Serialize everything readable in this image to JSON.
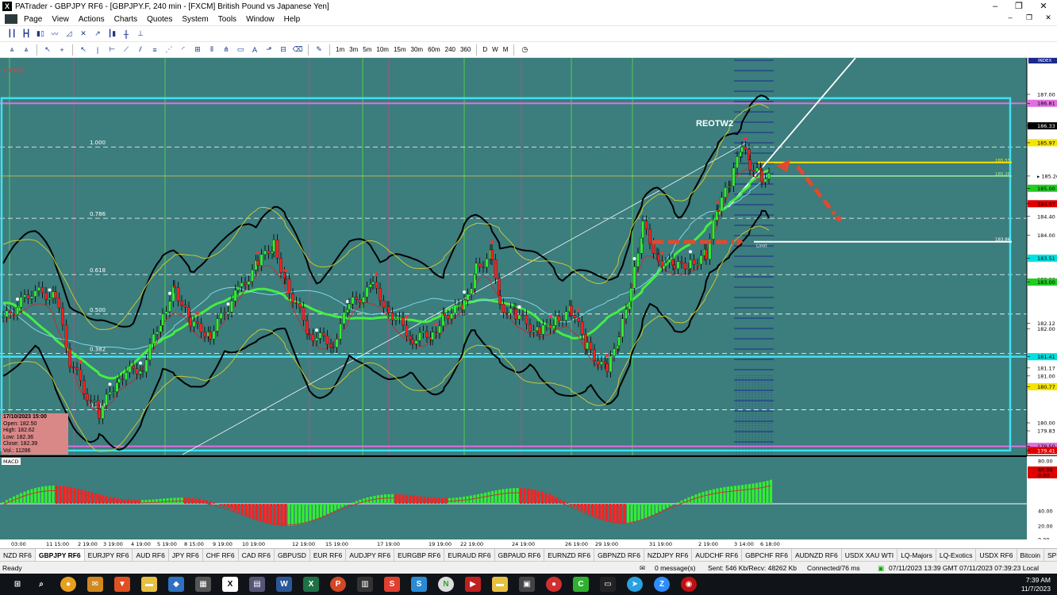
{
  "window": {
    "title": "PATrader - GBPJPY RF6 - [GBPJPY.F, 240 min - [FXCM] British Pound vs Japanese Yen]",
    "app_icon": "X",
    "controls": [
      "–",
      "❐",
      "✕"
    ],
    "mdi_controls": [
      "–",
      "❐",
      "✕"
    ]
  },
  "menu": {
    "items": [
      "Page",
      "View",
      "Actions",
      "Charts",
      "Quotes",
      "System",
      "Tools",
      "Window",
      "Help"
    ]
  },
  "toolbar2": {
    "timeframes": [
      "1m",
      "3m",
      "5m",
      "10m",
      "15m",
      "30m",
      "60m",
      "240",
      "360"
    ],
    "periods": [
      "D",
      "W",
      "M"
    ]
  },
  "chart": {
    "locked_label": "Locked",
    "annotation": "REOTW2",
    "index_label": "INDEX",
    "fib_levels": [
      {
        "label": "1.000",
        "price": 185.88
      },
      {
        "label": "0.786",
        "price": 184.36
      },
      {
        "label": "0.618",
        "price": 183.16
      },
      {
        "label": "0.500",
        "price": 182.32
      },
      {
        "label": "0.382",
        "price": 181.48
      },
      {
        "label": "0.214",
        "price": 180.28
      }
    ],
    "price_axis": [
      {
        "price": 187.0,
        "label": "187.00",
        "bg": "",
        "fg": "#000000"
      },
      {
        "price": 186.81,
        "label": "186.81",
        "bg": "#e070e0",
        "fg": "#000000"
      },
      {
        "price": 186.33,
        "label": "186.33",
        "bg": "#000000",
        "fg": "#ffffff"
      },
      {
        "price": 185.97,
        "label": "185.97",
        "bg": "#f5e400",
        "fg": "#000000"
      },
      {
        "price": 185.26,
        "label": "▸ 185.26",
        "bg": "#ffffff",
        "fg": "#000000"
      },
      {
        "price": 185.0,
        "label": "185.00",
        "bg": "#22cc22",
        "fg": "#000000"
      },
      {
        "price": 184.67,
        "label": "184.67",
        "bg": "#e00000",
        "fg": "#000000"
      },
      {
        "price": 184.4,
        "label": "184.40",
        "bg": "#ffffff",
        "fg": "#000000"
      },
      {
        "price": 184.0,
        "label": "184.00",
        "bg": "",
        "fg": "#000000"
      },
      {
        "price": 183.51,
        "label": "183.51",
        "bg": "#00e0e0",
        "fg": "#000000"
      },
      {
        "price": 183.06,
        "label": "183.06",
        "bg": "#ffffff",
        "fg": "#000000"
      },
      {
        "price": 183.0,
        "label": "183.00",
        "bg": "#22cc22",
        "fg": "#000000"
      },
      {
        "price": 182.12,
        "label": "182.12",
        "bg": "#ffffff",
        "fg": "#000000"
      },
      {
        "price": 182.0,
        "label": "182.00",
        "bg": "",
        "fg": "#000000"
      },
      {
        "price": 181.41,
        "label": "181.41",
        "bg": "#00e0e0",
        "fg": "#000000"
      },
      {
        "price": 181.17,
        "label": "181.17",
        "bg": "#ffffff",
        "fg": "#000000"
      },
      {
        "price": 181.0,
        "label": "181.00",
        "bg": "",
        "fg": "#000000"
      },
      {
        "price": 180.77,
        "label": "180.77",
        "bg": "#f5e400",
        "fg": "#000000"
      },
      {
        "price": 180.0,
        "label": "180.00",
        "bg": "",
        "fg": "#000000"
      },
      {
        "price": 179.83,
        "label": "179.83",
        "bg": "#ffffff",
        "fg": "#000000"
      },
      {
        "price": 179.5,
        "label": "179.50",
        "bg": "#e070e0",
        "fg": "#000000"
      },
      {
        "price": 179.41,
        "label": "179.41",
        "bg": "#e00000",
        "fg": "#ffffff"
      }
    ],
    "level_labels": [
      {
        "label": "185.55",
        "price": 185.55,
        "color": "#f5e400"
      },
      {
        "label": "185.26",
        "price": 185.26,
        "color": "#9af09a"
      },
      {
        "label": "183.86",
        "price": 183.86,
        "color": "#ffffff"
      }
    ],
    "limit_label": "Limit",
    "macd": {
      "label": "MACD",
      "axis": [
        "80.00",
        "60.00",
        "0.00",
        "40.00",
        "20.00",
        "0.00"
      ]
    },
    "time_axis": [
      "03:00",
      "11 15:00",
      "2 19:00",
      "3 19:00",
      "4 19:00",
      "5 19:00",
      "8 15:00",
      "9 19:00",
      "10 19:00",
      "12 19:00",
      "15 19:00",
      "17 19:00",
      "19 19:00",
      "22 19:00",
      "24 19:00",
      "26 19:00",
      "29 19:00",
      "31 19:00",
      "2 19:00",
      "3 14:00",
      "6 18:00"
    ],
    "ohlc": {
      "time": "17/10/2023 15:00",
      "open": "Open: 182.50",
      "high": "High: 182.62",
      "low": "Low: 182.36",
      "close": "Close: 182.39",
      "vol": "Vol.: 11286"
    }
  },
  "symbol_tabs": [
    "NZD RF6",
    "GBPJPY RF6",
    "EURJPY RF6",
    "AUD RF6",
    "JPY RF6",
    "CHF RF6",
    "CAD RF6",
    "GBPUSD",
    "EUR RF6",
    "AUDJPY RF6",
    "EURGBP RF6",
    "EURAUD RF6",
    "GBPAUD RF6",
    "EURNZD RF6",
    "GBPNZD RF6",
    "NZDJPY RF6",
    "AUDCHF RF6",
    "GBPCHF RF6",
    "AUDNZD RF6",
    "USDX XAU WTI",
    "LQ-Majors",
    "LQ-Exotics",
    "USDX RF6",
    "Bitcoin",
    "SP500",
    "DJIA"
  ],
  "active_symbol": "GBPJPY RF6",
  "status": {
    "ready": "Ready",
    "messages": "0 message(s)",
    "traffic": "Sent: 546 Kb/Recv: 48262 Kb",
    "connection": "Connected/76 ms",
    "times": "07/11/2023 13:39 GMT   07/11/2023 07:39:23 Local"
  },
  "taskbar": {
    "time": "7:39 AM",
    "date": "11/7/2023"
  },
  "colors": {
    "chart_bg": "#3c7d7d",
    "bull": "#33ee33",
    "bear": "#ff2020",
    "cyan_box": "#40e0f0",
    "magenta": "#e070e0",
    "yellow": "#f5e400",
    "arrow": "#e04a30"
  }
}
